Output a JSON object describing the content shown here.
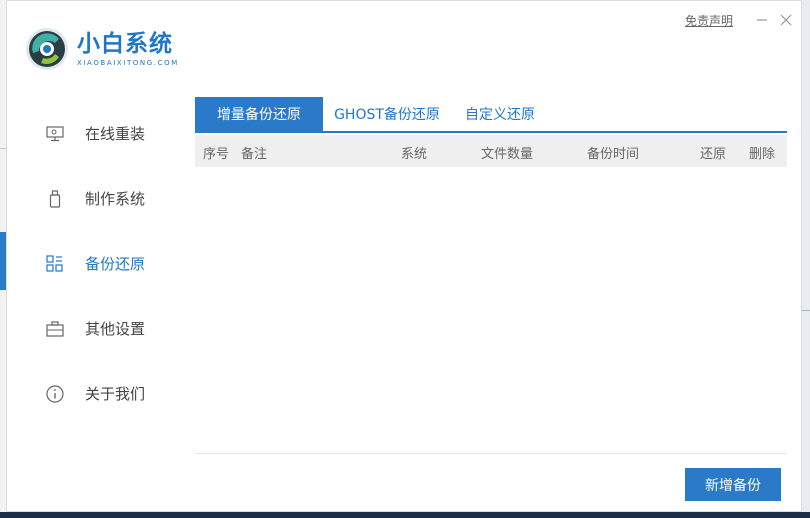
{
  "app": {
    "brand_name": "小白系统",
    "brand_sub": "XIAOBAIXITONG.COM",
    "disclaimer": "免责声明"
  },
  "sidebar": {
    "items": [
      {
        "label": "在线重装",
        "icon": "monitor-icon"
      },
      {
        "label": "制作系统",
        "icon": "usb-drive-icon"
      },
      {
        "label": "备份还原",
        "icon": "backup-grid-icon",
        "active": true
      },
      {
        "label": "其他设置",
        "icon": "briefcase-icon"
      },
      {
        "label": "关于我们",
        "icon": "info-icon"
      }
    ]
  },
  "tabs": [
    {
      "label": "增量备份还原",
      "active": true
    },
    {
      "label": "GHOST备份还原",
      "active": false
    },
    {
      "label": "自定义还原",
      "active": false
    }
  ],
  "table": {
    "columns": [
      "序号",
      "备注",
      "系统",
      "文件数量",
      "备份时间",
      "还原",
      "删除"
    ],
    "rows": []
  },
  "actions": {
    "add_backup": "新增备份"
  },
  "colors": {
    "accent": "#2b79c9",
    "brand": "#1f77c8",
    "header_bg": "#efefef"
  }
}
